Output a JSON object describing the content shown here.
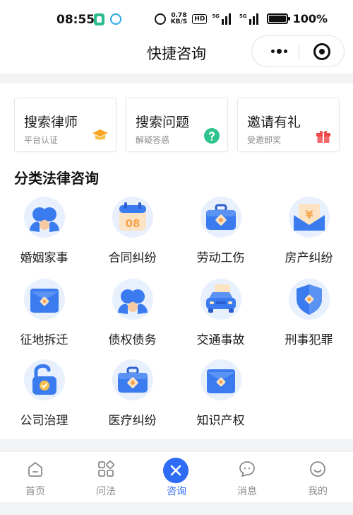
{
  "status_bar": {
    "time": "08:55",
    "net_speed_value": "0.78",
    "net_speed_unit": "KB/S",
    "hd": "HD",
    "signal1_label": "5G",
    "signal2_label": "5G",
    "battery_text": "100%",
    "battery_level": 1.0
  },
  "nav": {
    "title": "快捷咨询"
  },
  "quick_cards": [
    {
      "title": "搜索律师",
      "subtitle": "平台认证",
      "icon": "graduation-cap-icon",
      "color": "#f5a623"
    },
    {
      "title": "搜索问题",
      "subtitle": "解疑答惑",
      "icon": "question-icon",
      "color": "#2fc38e"
    },
    {
      "title": "邀请有礼",
      "subtitle": "受邀即奖",
      "icon": "gift-icon",
      "color": "#f0474a"
    }
  ],
  "section": {
    "title": "分类法律咨询"
  },
  "categories": [
    {
      "label": "婚姻家事",
      "icon": "couple-icon"
    },
    {
      "label": "合同纠纷",
      "icon": "calendar-icon",
      "icon_text": "08"
    },
    {
      "label": "劳动工伤",
      "icon": "toolbox-icon"
    },
    {
      "label": "房产纠纷",
      "icon": "money-envelope-icon",
      "icon_text": "¥"
    },
    {
      "label": "征地拆迁",
      "icon": "wallet-icon"
    },
    {
      "label": "债权债务",
      "icon": "couple-icon"
    },
    {
      "label": "交通事故",
      "icon": "car-icon"
    },
    {
      "label": "刑事犯罪",
      "icon": "shield-icon"
    },
    {
      "label": "公司治理",
      "icon": "unlocked-padlock-icon"
    },
    {
      "label": "医疗纠纷",
      "icon": "toolbox-icon"
    },
    {
      "label": "知识产权",
      "icon": "wallet-icon"
    }
  ],
  "tabs": [
    {
      "label": "首页",
      "icon": "home-icon"
    },
    {
      "label": "问法",
      "icon": "grid-icon"
    },
    {
      "label": "咨询",
      "icon": "close-icon",
      "active": true
    },
    {
      "label": "消息",
      "icon": "message-icon"
    },
    {
      "label": "我的",
      "icon": "smile-icon"
    }
  ],
  "colors": {
    "accent": "#2f6cf6",
    "icon_blue": "#3a7bf0",
    "icon_orange": "#f7a24a",
    "icon_bg": "#e8f0fe"
  }
}
